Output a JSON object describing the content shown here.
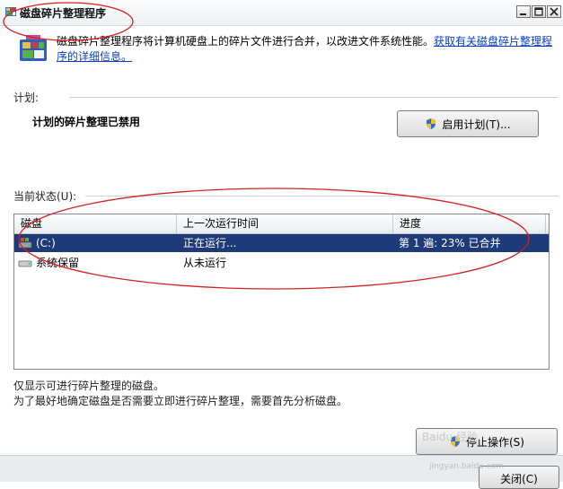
{
  "window": {
    "title": "磁盘碎片整理程序"
  },
  "header": {
    "description": "磁盘碎片整理程序将计算机硬盘上的碎片文件进行合并，以改进文件系统性能。",
    "link": "获取有关磁盘碎片整理程序的详细信息。"
  },
  "schedule": {
    "section_label": "计划:",
    "status": "计划的碎片整理已禁用",
    "enable_button": "启用计划(T)..."
  },
  "current": {
    "section_label": "当前状态(U):",
    "columns": [
      "磁盘",
      "上一次运行时间",
      "进度"
    ],
    "rows": [
      {
        "disk": "(C:)",
        "last_run": "正在运行...",
        "progress": "第 1 遍: 23% 已合并",
        "selected": true
      },
      {
        "disk": "系统保留",
        "last_run": "从未运行",
        "progress": "",
        "selected": false
      }
    ]
  },
  "notes": {
    "line1": "仅显示可进行碎片整理的磁盘。",
    "line2": "为了最好地确定磁盘是否需要立即进行碎片整理，需要首先分析磁盘。"
  },
  "actions": {
    "stop_button": "停止操作(S)",
    "close_button": "关闭(C)"
  },
  "watermark": {
    "brand": "Baidu 经验",
    "url": "jingyan.baidu.com"
  },
  "colors": {
    "selection": "#1e3a78",
    "link": "#0b3fc2",
    "annotation": "#d42020"
  }
}
